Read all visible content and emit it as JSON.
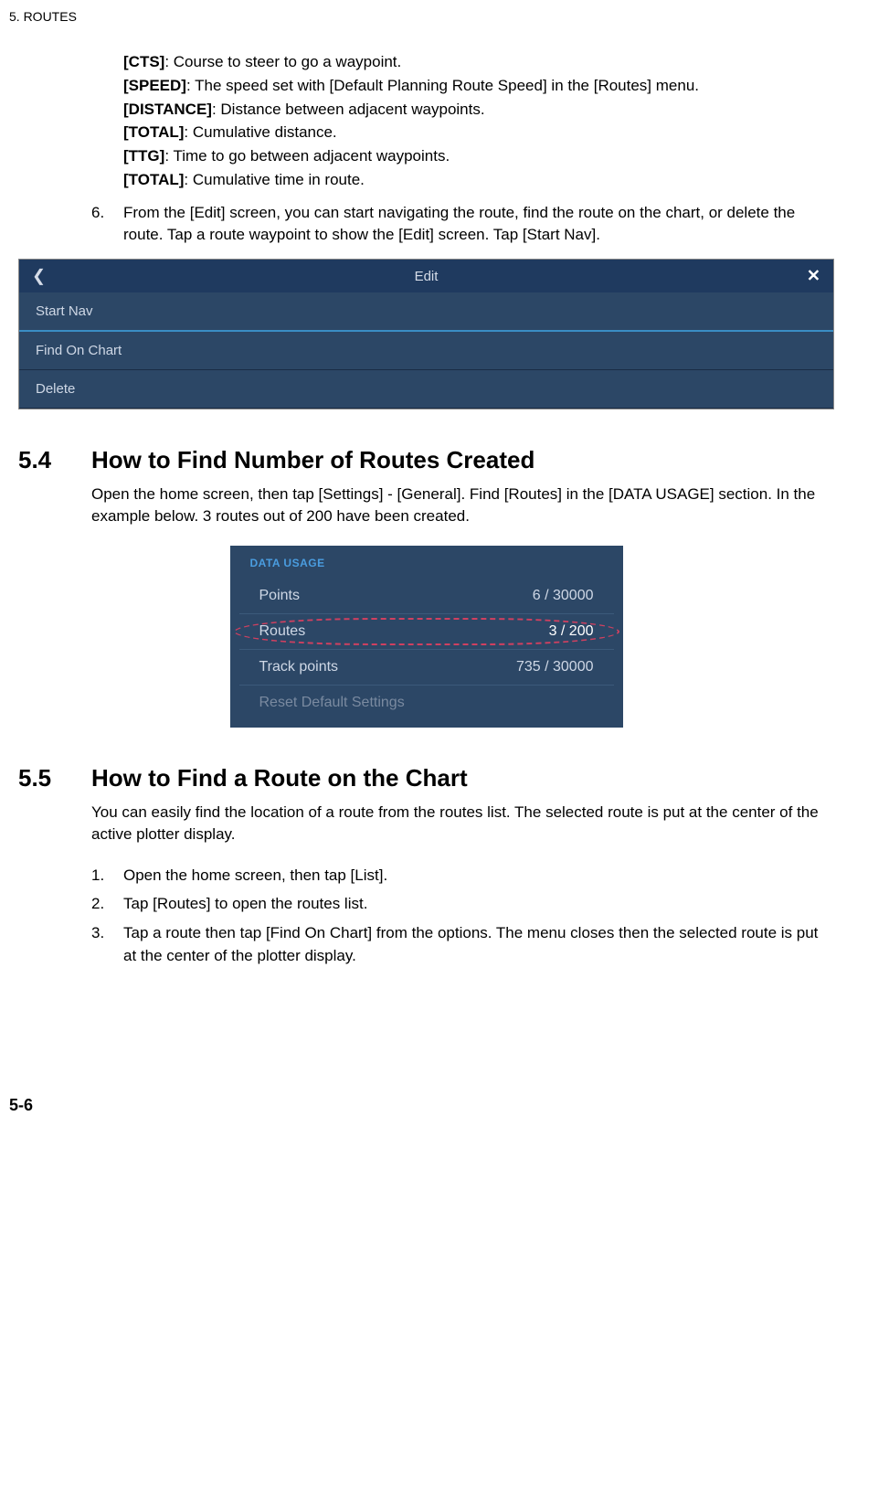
{
  "header": {
    "chapter": "5.  ROUTES"
  },
  "definitions": [
    {
      "term": "[CTS]",
      "desc": ": Course to steer to go a waypoint."
    },
    {
      "term": "[SPEED]",
      "desc": ": The speed set with [Default Planning Route Speed] in the [Routes] menu."
    },
    {
      "term": "[DISTANCE]",
      "desc": ": Distance between adjacent waypoints."
    },
    {
      "term": "[TOTAL]",
      "desc": ": Cumulative distance."
    },
    {
      "term": "[TTG]",
      "desc": ": Time to go between adjacent waypoints."
    },
    {
      "term": "[TOTAL]",
      "desc": ": Cumulative time in route."
    }
  ],
  "step6": {
    "num": "6.",
    "text": "From the [Edit] screen, you can start navigating the route, find the route on the chart, or delete the route. Tap a route waypoint to show the [Edit] screen. Tap [Start Nav]."
  },
  "editScreen": {
    "title": "Edit",
    "items": [
      "Start Nav",
      "Find On Chart",
      "Delete"
    ]
  },
  "section54": {
    "num": "5.4",
    "title": "How to Find Number of Routes Created",
    "body": "Open the home screen, then tap [Settings] - [General]. Find [Routes] in the [DATA USAGE] section. In the example below. 3 routes out of 200 have been created."
  },
  "dataUsage": {
    "header": "DATA USAGE",
    "rows": [
      {
        "label": "Points",
        "value": "6 / 30000"
      },
      {
        "label": "Routes",
        "value": "3 / 200"
      },
      {
        "label": "Track points",
        "value": "735 / 30000"
      },
      {
        "label": "Reset Default Settings",
        "value": ""
      }
    ]
  },
  "section55": {
    "num": "5.5",
    "title": "How to Find a Route on the Chart",
    "body": "You can easily find the location of a route from the routes list. The selected route is put at the center of the active plotter display.",
    "steps": [
      {
        "n": "1.",
        "t": "Open the home screen, then tap [List]."
      },
      {
        "n": "2.",
        "t": "Tap [Routes] to open the routes list."
      },
      {
        "n": "3.",
        "t": "Tap a route then tap [Find On Chart] from the options. The menu closes then the selected route is put at the center of the plotter display."
      }
    ]
  },
  "footer": {
    "pagenum": "5-6"
  }
}
